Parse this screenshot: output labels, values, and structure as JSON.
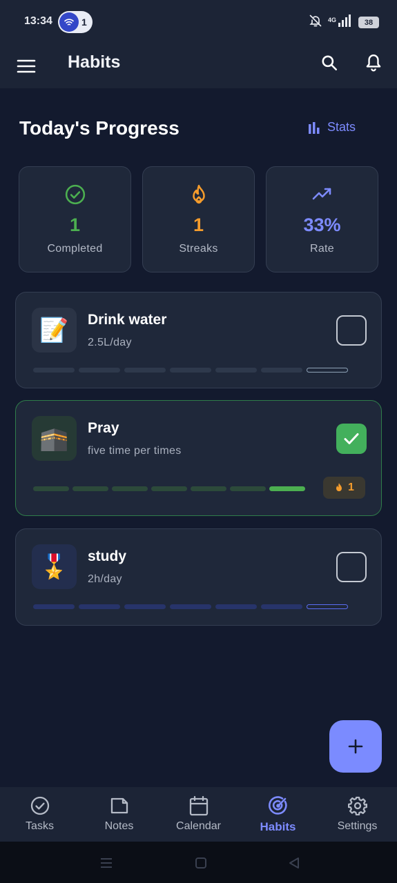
{
  "status_bar": {
    "time": "13:34",
    "notification_count": "1",
    "network_label": "4G",
    "battery": "38"
  },
  "app_bar": {
    "title": "Habits"
  },
  "progress": {
    "title": "Today's Progress",
    "stats_label": "Stats",
    "cards": [
      {
        "icon": "check-circle-icon",
        "value": "1",
        "label": "Completed",
        "color": "#4caf50"
      },
      {
        "icon": "fire-icon",
        "value": "1",
        "label": "Streaks",
        "color": "#f59c2c"
      },
      {
        "icon": "trending-up-icon",
        "value": "33%",
        "label": "Rate",
        "color": "#7d8bff"
      }
    ]
  },
  "habits": [
    {
      "emoji": "📝",
      "name": "Drink water",
      "description": "2.5L/day",
      "completed": false,
      "week_progress": [
        0,
        0,
        0,
        0,
        0,
        0,
        0
      ],
      "color": "#8fa3b8"
    },
    {
      "emoji": "🕋",
      "name": "Pray",
      "description": "five time per times",
      "completed": true,
      "week_progress": [
        0,
        0,
        0,
        0,
        0,
        0,
        1
      ],
      "streak": "1",
      "color": "#4caf50"
    },
    {
      "emoji": "🎖️",
      "name": "study",
      "description": "2h/day",
      "completed": false,
      "week_progress": [
        0,
        0,
        0,
        0,
        0,
        0,
        0
      ],
      "color": "#5b6ef5"
    }
  ],
  "fab": {
    "icon": "plus-icon"
  },
  "bottom_nav": [
    {
      "label": "Tasks",
      "icon": "check-circle-icon",
      "active": false
    },
    {
      "label": "Notes",
      "icon": "note-icon",
      "active": false
    },
    {
      "label": "Calendar",
      "icon": "calendar-icon",
      "active": false
    },
    {
      "label": "Habits",
      "icon": "target-icon",
      "active": true
    },
    {
      "label": "Settings",
      "icon": "gear-icon",
      "active": false
    }
  ],
  "colors": {
    "background": "#131a2e",
    "card": "#1f283a",
    "accent": "#7d8bff",
    "success": "#4caf50",
    "warning": "#f59c2c"
  }
}
